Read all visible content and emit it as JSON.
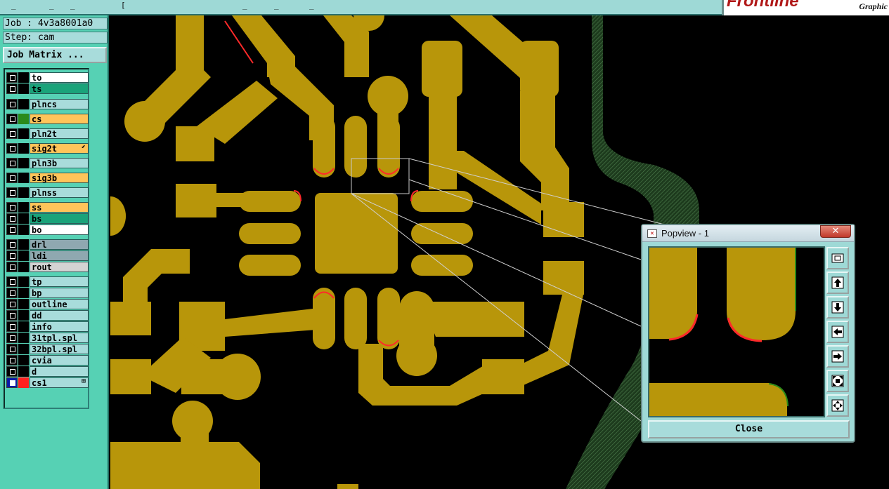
{
  "topbar": {
    "brand": "Frontline",
    "brand_sub": "Graphic"
  },
  "job": {
    "job_label": "Job : 4v3a8001a0",
    "step_label": "Step: cam",
    "matrix_button": "Job Matrix ..."
  },
  "layers": [
    {
      "name": "to",
      "bg": "#ffffff",
      "indicator": "#000000"
    },
    {
      "name": "ts",
      "bg": "#1aa37a",
      "indicator": "#000000"
    },
    {
      "name": "plncs",
      "bg": "#a8dcdb",
      "indicator": "#000000"
    },
    {
      "name": "cs",
      "bg": "#ffc45a",
      "indicator": "#2a8a1a"
    },
    {
      "name": "pln2t",
      "bg": "#a8dcdb",
      "indicator": "#000000"
    },
    {
      "name": "sig2t",
      "bg": "#ffc45a",
      "indicator": "#000000",
      "extra": "⬋"
    },
    {
      "name": "pln3b",
      "bg": "#a8dcdb",
      "indicator": "#000000"
    },
    {
      "name": "sig3b",
      "bg": "#ffc45a",
      "indicator": "#000000"
    },
    {
      "name": "plnss",
      "bg": "#a8dcdb",
      "indicator": "#000000"
    },
    {
      "name": "ss",
      "bg": "#ffc45a",
      "indicator": "#000000"
    },
    {
      "name": "bs",
      "bg": "#1aa37a",
      "indicator": "#000000"
    },
    {
      "name": "bo",
      "bg": "#ffffff",
      "indicator": "#000000"
    },
    {
      "name": "drl",
      "bg": "#8fa8b0",
      "indicator": "#000000"
    },
    {
      "name": "ldi",
      "bg": "#8fa8b0",
      "indicator": "#000000"
    },
    {
      "name": "rout",
      "bg": "#d3d3d3",
      "indicator": "#000000"
    },
    {
      "name": "tp",
      "bg": "#a8dcdb",
      "indicator": "#000000"
    },
    {
      "name": "bp",
      "bg": "#a8dcdb",
      "indicator": "#000000"
    },
    {
      "name": "outline",
      "bg": "#a8dcdb",
      "indicator": "#000000"
    },
    {
      "name": "dd",
      "bg": "#a8dcdb",
      "indicator": "#000000"
    },
    {
      "name": "info",
      "bg": "#a8dcdb",
      "indicator": "#000000"
    },
    {
      "name": "31tpl.spl",
      "bg": "#a8dcdb",
      "indicator": "#000000"
    },
    {
      "name": "32bpl.spl",
      "bg": "#a8dcdb",
      "indicator": "#000000"
    },
    {
      "name": "cvia",
      "bg": "#a8dcdb",
      "indicator": "#000000"
    },
    {
      "name": "d",
      "bg": "#a8dcdb",
      "indicator": "#000000"
    },
    {
      "name": "cs1",
      "bg": "#a8dcdb",
      "indicator": "#ff2020",
      "extra": "⊞",
      "checkbox": "blue"
    }
  ],
  "popview": {
    "title": "Popview - 1",
    "close_x": "✕",
    "close_label": "Close",
    "tools": [
      "zoom-fit-icon",
      "pan-up-icon",
      "pan-down-icon",
      "pan-left-icon",
      "pan-right-icon",
      "zoom-in-icon",
      "zoom-out-icon"
    ]
  },
  "colors": {
    "copper": "#b8960a",
    "plane_hatch": "#2e5a2e",
    "panel": "#56d1b4",
    "widget": "#a8dcdb"
  }
}
